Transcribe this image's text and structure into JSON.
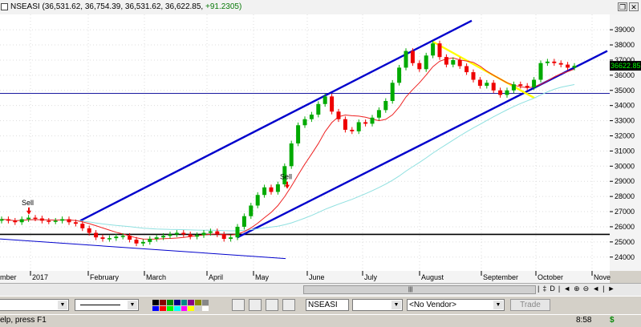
{
  "window": {
    "title_symbol": "NSEASI",
    "title_values": "(36,531.62, 36,754.39, 36,531.62, 36,622.85, ",
    "title_change": "+91.2305)",
    "restore_label": "❐",
    "close_label": "✕"
  },
  "chart_data": {
    "type": "candlestick",
    "symbol": "NSEASI",
    "y_ticks": [
      24000,
      25000,
      26000,
      27000,
      28000,
      29000,
      30000,
      31000,
      32000,
      33000,
      34000,
      35000,
      36000,
      37000,
      38000,
      39000
    ],
    "ylim": [
      23300,
      39800
    ],
    "x_labels": [
      "mber",
      "2017",
      "February",
      "March",
      "April",
      "May",
      "June",
      "July",
      "August",
      "September",
      "October",
      "Nove"
    ],
    "last_price": "36622.85",
    "sell_labels": [
      {
        "text": "Sell",
        "month_pos": "late-December"
      },
      {
        "text": "Sell",
        "month_pos": "mid-May"
      }
    ],
    "horizontal_lines": [
      {
        "value": 34800,
        "color": "#1a1aa0"
      },
      {
        "value": 25500,
        "color": "#000000"
      }
    ],
    "close_series": [
      26500,
      26400,
      26300,
      26500,
      26600,
      26550,
      26400,
      26350,
      26400,
      26500,
      26300,
      26200,
      25900,
      25600,
      25300,
      25200,
      25250,
      25350,
      25400,
      25150,
      24900,
      25000,
      25200,
      25300,
      25400,
      25500,
      25600,
      25500,
      25350,
      25450,
      25600,
      25700,
      25500,
      25200,
      25300,
      26000,
      26700,
      27400,
      28100,
      28600,
      28300,
      28800,
      30000,
      31500,
      32700,
      33100,
      33400,
      34100,
      34600,
      33600,
      33100,
      32400,
      32300,
      32900,
      32800,
      33200,
      33700,
      34300,
      35500,
      36500,
      37600,
      36800,
      36400,
      37300,
      38100,
      37200,
      36700,
      37000,
      36600,
      36200,
      35700,
      35300,
      35500,
      35000,
      34700,
      35000,
      35400,
      35300,
      35200,
      35700,
      36800,
      36900,
      36800,
      36700,
      36500,
      36622
    ]
  },
  "toolbar": {
    "symbol_field": "NSEASI",
    "vendor": "<No Vendor>",
    "trade_button": "Trade"
  },
  "scroll_icons": [
    "|",
    "‡",
    "D",
    "|",
    "◄",
    "⊕",
    "⊖",
    "◄",
    "|",
    "►"
  ],
  "status": {
    "help_text": "elp, press F1",
    "time": "8:58",
    "dollar": "$"
  },
  "colors": {
    "up": "#00aa00",
    "down": "#ee0000",
    "channel": "#0000cc",
    "yellow_trend": "#ffff00",
    "ma_red": "#ee2222",
    "ma_cyan": "#8fe0e0",
    "price_tag_bg": "#000000",
    "price_tag_fg": "#00ff00"
  }
}
